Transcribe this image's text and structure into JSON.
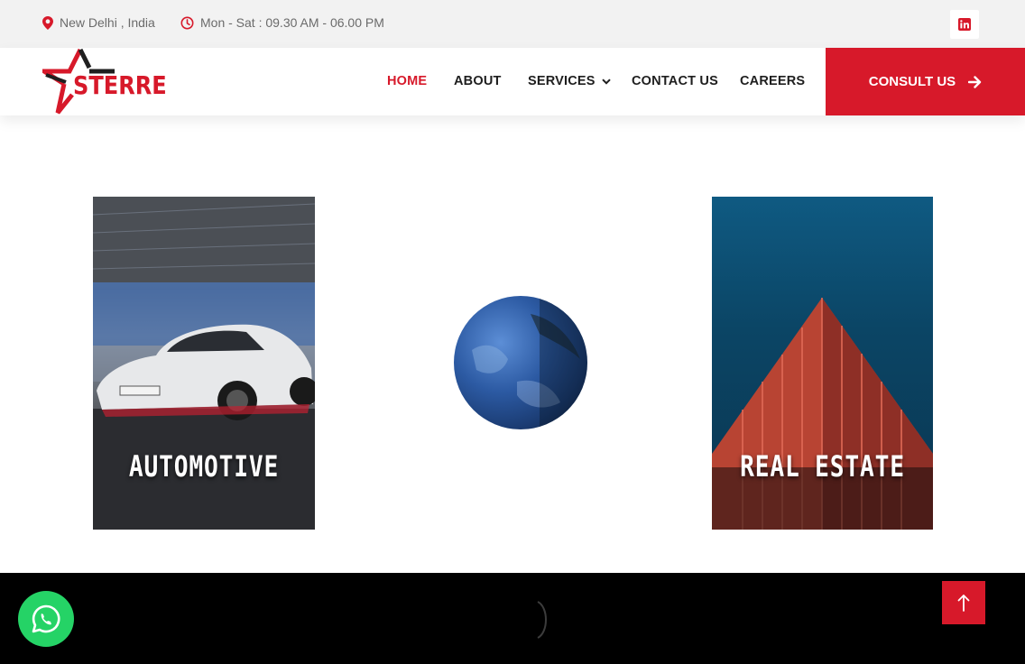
{
  "topbar": {
    "location": "New Delhi , India",
    "hours": "Mon - Sat : 09.30 AM - 06.00 PM",
    "social_icon": "linkedin-icon"
  },
  "header": {
    "logo_text": "STERRE",
    "nav": [
      {
        "label": "HOME",
        "active": true
      },
      {
        "label": "ABOUT",
        "active": false
      },
      {
        "label": "SERVICES",
        "active": false
      },
      {
        "label": "CONTACT US",
        "active": false
      },
      {
        "label": "CAREERS",
        "active": false
      }
    ],
    "cta_label": "CONSULT US"
  },
  "cards": [
    {
      "label": "AUTOMOTIVE"
    },
    {
      "label": "REAL ESTATE"
    }
  ],
  "floating": {
    "whatsapp_icon": "whatsapp-icon",
    "scroll_top_icon": "arrow-up-icon"
  },
  "colors": {
    "brand_red": "#d7192a",
    "whatsapp_green": "#25d366",
    "topbar_bg": "#f2f2f2"
  }
}
